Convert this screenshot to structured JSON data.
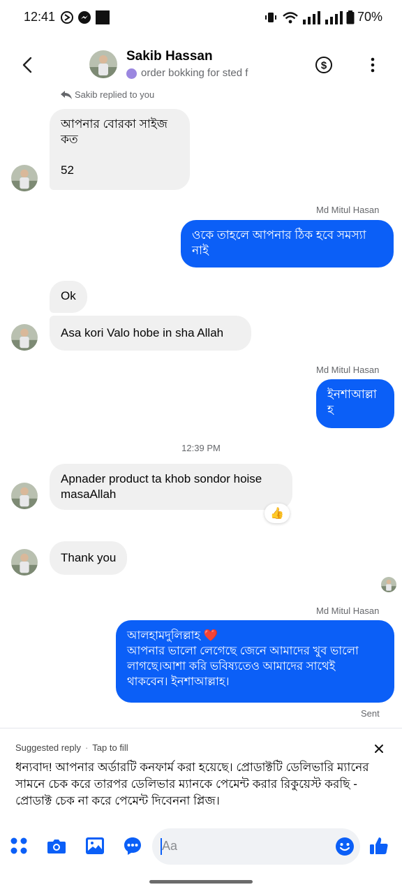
{
  "status_bar": {
    "time": "12:41",
    "battery": "70%"
  },
  "header": {
    "name": "Sakib Hassan",
    "subtitle": "order bokking for sted f",
    "back_icon": "chevron-left-icon",
    "dollar_icon": "dollar-circle-icon",
    "more_icon": "more-vertical-icon"
  },
  "messages": {
    "replied_note": "Sakib replied to you",
    "m1": "আপনার বোরকা সাইজ\nকত\n\n52",
    "sender_label_1": "Md Mitul Hasan",
    "m2": "ওকে তাহলে আপনার ঠিক হবে সমস্যা\nনাই",
    "m3": "Ok",
    "m4": "Asa kori Valo hobe in sha Allah",
    "sender_label_2": "Md Mitul Hasan",
    "m5": "ইনশাআল্লা\nহ",
    "timestamp": "12:39 PM",
    "m6": "Apnader product ta khob sondor hoise\nmasaAllah",
    "m6_reaction": "👍",
    "m7": "Thank you",
    "sender_label_3": "Md Mitul Hasan",
    "m8": "আলহামদুলিল্লাহ ❤️\nআপনার ভালো লেগেছে জেনে আমাদের খুব ভালো\nলাগছে।আশা করি ভবিষ্যতেও আমাদের সাথেই\nথাকবেন। ইনশাআল্লাহ।",
    "sent_status": "Sent"
  },
  "suggested_reply": {
    "label": "Suggested reply",
    "action": "Tap to fill",
    "text": "ধন্যবাদ! আপনার অর্ডারটি কনফার্ম করা হয়েছে। প্রোডাক্টটি ডেলিভারি ম্যানের সামনে চেক করে তারপর ডেলিভার ম্যানকে পেমেন্ট করার রিকুয়েস্ট করছি - প্রোডাক্ট চেক না করে পেমেন্ট দিবেননা প্লিজ।"
  },
  "composer": {
    "placeholder": "Aa"
  },
  "colors": {
    "accent": "#0b5ff7",
    "incoming_bubble": "#f0f0f0",
    "status_dot": "#9b87e0"
  }
}
